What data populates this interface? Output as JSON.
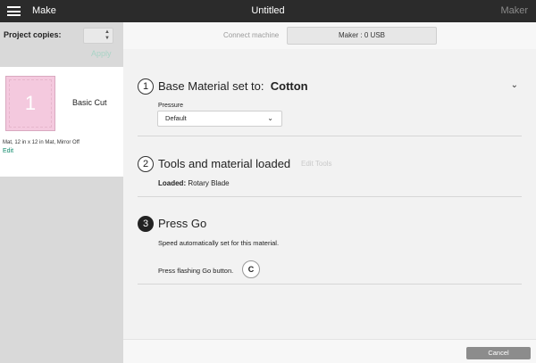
{
  "topbar": {
    "make_label": "Make",
    "title": "Untitled",
    "right_label": "Maker",
    "menu_icon": "hamburger-icon"
  },
  "sidebar": {
    "copies_label": "Project copies:",
    "copies_value": "",
    "apply_label": "Apply",
    "mat_number": "1",
    "mat_type": "Basic Cut",
    "mat_info": "Mat, 12 in x 12 in Mat, Mirror Off",
    "edit_label": "Edit"
  },
  "connect": {
    "label": "Connect machine",
    "machine": "Maker : 0 USB"
  },
  "steps": {
    "step1": {
      "number": "1",
      "title_prefix": "Base Material set to:",
      "material": "Cotton",
      "pressure_label": "Pressure",
      "pressure_value": "Default"
    },
    "step2": {
      "number": "2",
      "title": "Tools and material loaded",
      "edit_tools": "Edit Tools",
      "loaded_label": "Loaded:",
      "loaded_value": "Rotary Blade"
    },
    "step3": {
      "number": "3",
      "title": "Press Go",
      "speed_text": "Speed automatically set for this material.",
      "press_text": "Press flashing Go button.",
      "go_icon": "C"
    }
  },
  "bottombar": {
    "cancel_label": "Cancel"
  }
}
